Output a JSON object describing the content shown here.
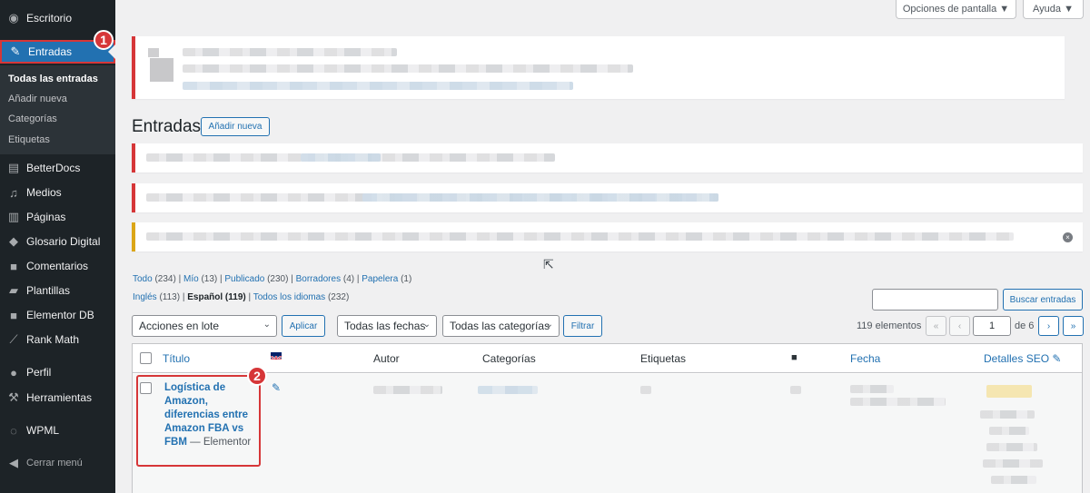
{
  "sidebar": {
    "items": [
      {
        "label": "Escritorio",
        "icon": "dashboard-icon"
      },
      {
        "label": "Entradas",
        "icon": "pin-icon"
      },
      {
        "label": "BetterDocs",
        "icon": "docs-icon"
      },
      {
        "label": "Medios",
        "icon": "media-icon"
      },
      {
        "label": "Páginas",
        "icon": "pages-icon"
      },
      {
        "label": "Glosario Digital",
        "icon": "graduation-cap-icon"
      },
      {
        "label": "Comentarios",
        "icon": "comment-icon"
      },
      {
        "label": "Plantillas",
        "icon": "folder-icon"
      },
      {
        "label": "Elementor DB",
        "icon": "comment-icon"
      },
      {
        "label": "Rank Math",
        "icon": "chart-icon"
      },
      {
        "label": "Perfil",
        "icon": "user-icon"
      },
      {
        "label": "Herramientas",
        "icon": "wrench-icon"
      },
      {
        "label": "WPML",
        "icon": "wpml-icon"
      },
      {
        "label": "Cerrar menú",
        "icon": "collapse-icon"
      }
    ],
    "submenu": [
      "Todas las entradas",
      "Añadir nueva",
      "Categorías",
      "Etiquetas"
    ]
  },
  "callouts": [
    "1",
    "2"
  ],
  "screen_options": "Opciones de pantalla ▼",
  "help": "Ayuda ▼",
  "page_title": "Entradas",
  "add_new": "Añadir nueva",
  "filters": {
    "status": [
      {
        "label": "Todo",
        "count": "(234)"
      },
      {
        "label": "Mío",
        "count": "(13)"
      },
      {
        "label": "Publicado",
        "count": "(230)"
      },
      {
        "label": "Borradores",
        "count": "(4)"
      },
      {
        "label": "Papelera",
        "count": "(1)"
      }
    ],
    "langs": [
      {
        "label": "Inglés",
        "count": "(113)"
      },
      {
        "label": "Español",
        "count": "(119)"
      },
      {
        "label": "Todos los idiomas",
        "count": "(232)"
      }
    ]
  },
  "search_button": "Buscar entradas",
  "bulk": {
    "value": "Acciones en lote",
    "apply": "Aplicar"
  },
  "dates": {
    "value": "Todas las fechas"
  },
  "categories": {
    "value": "Todas las categorías"
  },
  "filter_button": "Filtrar",
  "pagination": {
    "count": "119 elementos",
    "first": "«",
    "prev": "‹",
    "current": "1",
    "of": "de 6",
    "next": "›",
    "last": "»"
  },
  "columns": {
    "title": "Título",
    "author": "Autor",
    "categories": "Categorías",
    "tags": "Etiquetas",
    "date": "Fecha",
    "seo": "Detalles SEO"
  },
  "row": {
    "title": "Logística de Amazon, diferencias entre Amazon FBA vs FBM",
    "state": "— Elementor"
  },
  "colors": {
    "accent": "#2271b1",
    "sidebar": "#1d2327",
    "callout": "#d63638"
  }
}
